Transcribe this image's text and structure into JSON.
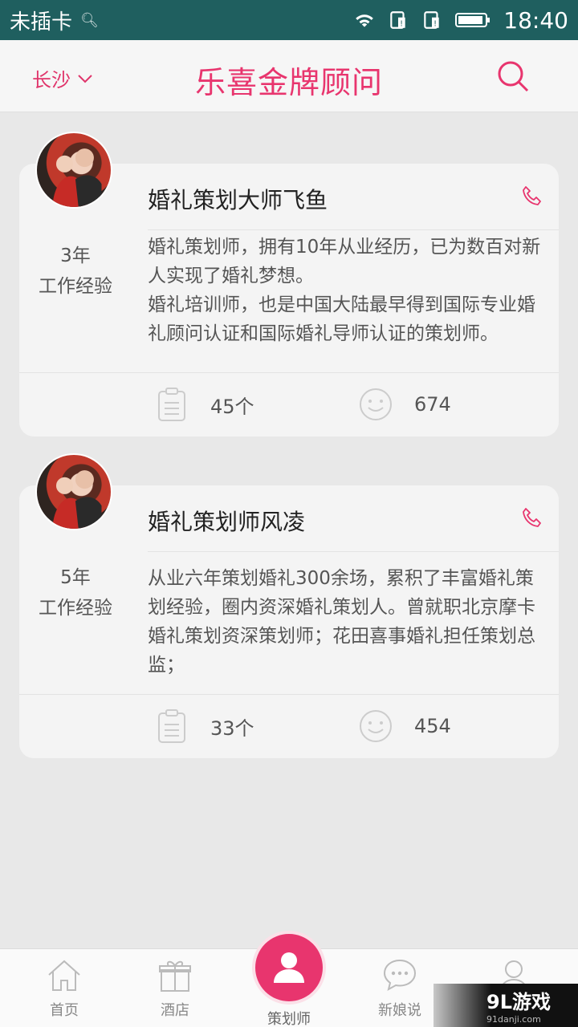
{
  "status_bar": {
    "carrier": "未插卡",
    "time": "18:40"
  },
  "header": {
    "city": "长沙",
    "title": "乐喜金牌顾问"
  },
  "planners": [
    {
      "name": "婚礼策划大师飞鱼",
      "experience_years": "3年",
      "experience_label": "工作经验",
      "description": "婚礼策划师，拥有10年从业经历，已为数百对新人实现了婚礼梦想。\n婚礼培训师，也是中国大陆最早得到国际专业婚礼顾问认证和国际婚礼导师认证的策划师。",
      "cases": "45个",
      "likes": "674"
    },
    {
      "name": "婚礼策划师风凌",
      "experience_years": "5年",
      "experience_label": "工作经验",
      "description": "从业六年策划婚礼300余场，累积了丰富婚礼策划经验，圈内资深婚礼策划人。曾就职北京摩卡婚礼策划资深策划师；花田喜事婚礼担任策划总监；",
      "cases": "33个",
      "likes": "454"
    }
  ],
  "tabbar": {
    "home": "首页",
    "hotel": "酒店",
    "planner": "策划师",
    "bride_talk": "新娘说",
    "profile": ""
  },
  "watermark": {
    "main": "9L游戏",
    "sub": "91danji.com"
  },
  "colors": {
    "accent": "#e8356e",
    "status_bar": "#1f5f5f"
  }
}
